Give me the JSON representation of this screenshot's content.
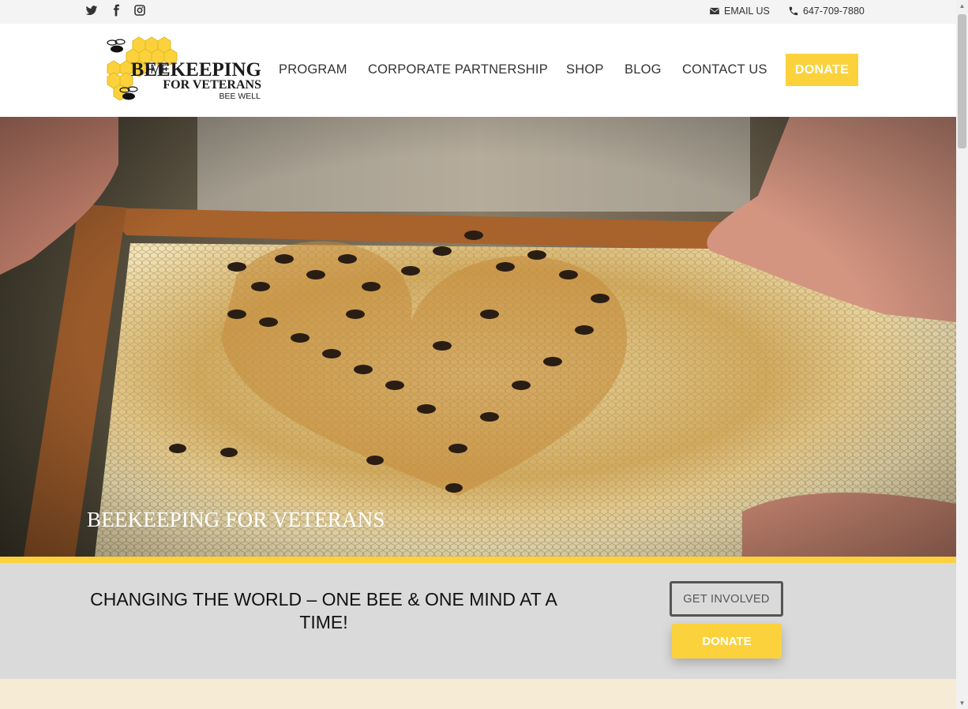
{
  "topbar": {
    "social_icons": [
      "twitter-icon",
      "facebook-icon",
      "instagram-icon"
    ],
    "email_label": "EMAIL US",
    "phone_label": "647-709-7880"
  },
  "logo": {
    "line1": "BEEKEEPING",
    "line2": "FOR VETERANS",
    "line3": "BEE WELL"
  },
  "nav": {
    "home": "HOME",
    "program": "PROGRAM",
    "corporate": "CORPORATE PARTNERSHIP",
    "shop": "SHOP",
    "blog": "BLOG",
    "contact": "CONTACT US",
    "donate": "DONATE"
  },
  "hero": {
    "title": "BEEKEEPING FOR VETERANS"
  },
  "band": {
    "tagline": "CHANGING THE WORLD – ONE BEE & ONE MIND AT A TIME!",
    "get_involved": "GET INVOLVED",
    "donate": "DONATE"
  },
  "colors": {
    "accent": "#fbd23c",
    "band_bg": "#dadada",
    "text": "#333333"
  }
}
